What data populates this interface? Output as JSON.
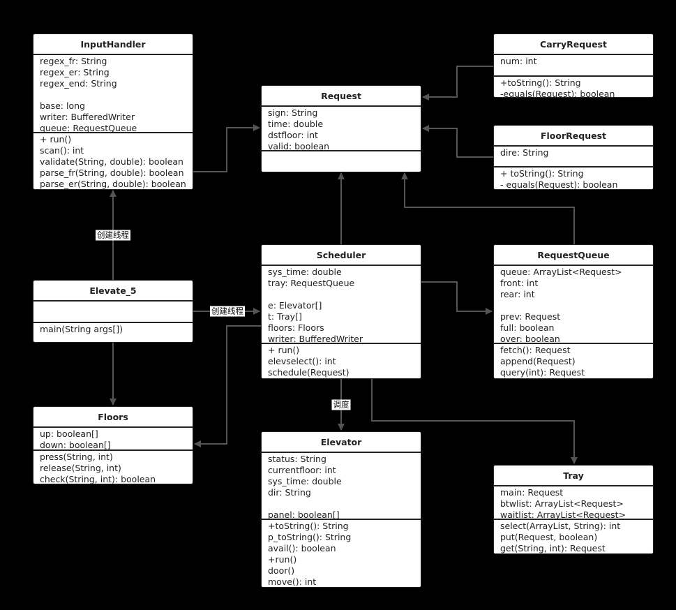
{
  "classes": {
    "inputhandler": {
      "name": "InputHandler",
      "attributes": [
        "regex_fr: String",
        "regex_er: String",
        "regex_end: String",
        "",
        "base: long",
        "writer: BufferedWriter",
        "queue: RequestQueue"
      ],
      "methods": [
        "+ run()",
        "scan(): int",
        "validate(String, double): boolean",
        "parse_fr(String, double): boolean",
        "parse_er(String, double): boolean"
      ]
    },
    "request": {
      "name": "Request",
      "attributes": [
        "sign: String",
        "time: double",
        "dstfloor: int",
        "valid: boolean"
      ],
      "methods": []
    },
    "carryrequest": {
      "name": "CarryRequest",
      "attributes": [
        "num: int"
      ],
      "methods": [
        "+toString(): String",
        "-equals(Request): boolean"
      ]
    },
    "floorrequest": {
      "name": "FloorRequest",
      "attributes": [
        "dire: String"
      ],
      "methods": [
        "+ toString(): String",
        "- equals(Request): boolean"
      ]
    },
    "elevate5": {
      "name": "Elevate_5",
      "attributes": [],
      "methods": [
        "main(String args[])"
      ]
    },
    "scheduler": {
      "name": "Scheduler",
      "attributes": [
        "sys_time: double",
        "tray: RequestQueue",
        "",
        "e: Elevator[]",
        "t: Tray[]",
        "floors: Floors",
        "writer: BufferedWriter"
      ],
      "methods": [
        "+ run()",
        "elevselect(): int",
        "schedule(Request)"
      ]
    },
    "requestqueue": {
      "name": "RequestQueue",
      "attributes": [
        "queue: ArrayList<Request>",
        "front: int",
        "rear: int",
        "",
        "prev: Request",
        "full: boolean",
        "over: boolean"
      ],
      "methods": [
        "fetch(): Request",
        "append(Request)",
        "query(int): Request"
      ]
    },
    "floors": {
      "name": "Floors",
      "attributes": [
        "up: boolean[]",
        "down: boolean[]"
      ],
      "methods": [
        "press(String, int)",
        "release(String, int)",
        "check(String, int): boolean"
      ]
    },
    "elevator": {
      "name": "Elevator",
      "attributes": [
        "status: String",
        "currentfloor: int",
        "sys_time: double",
        "dir: String",
        "",
        "panel: boolean[]"
      ],
      "methods": [
        "+toString(): String",
        "p_toString(): String",
        "avail(): boolean",
        "+run()",
        "door()",
        "move(): int"
      ]
    },
    "tray": {
      "name": "Tray",
      "attributes": [
        "main: Request",
        "btwlist: ArrayList<Request>",
        "waitlist: ArrayList<Request>"
      ],
      "methods": [
        "select(ArrayList, String): int",
        "put(Request, boolean)",
        "get(String, int): Request"
      ]
    }
  },
  "labels": {
    "create_thread_input": "创建线程",
    "create_thread_scheduler": "创建线程",
    "dispatch": "调度"
  },
  "colors": {
    "background": "#000000",
    "box": "#ffffff",
    "line": "#555555"
  }
}
